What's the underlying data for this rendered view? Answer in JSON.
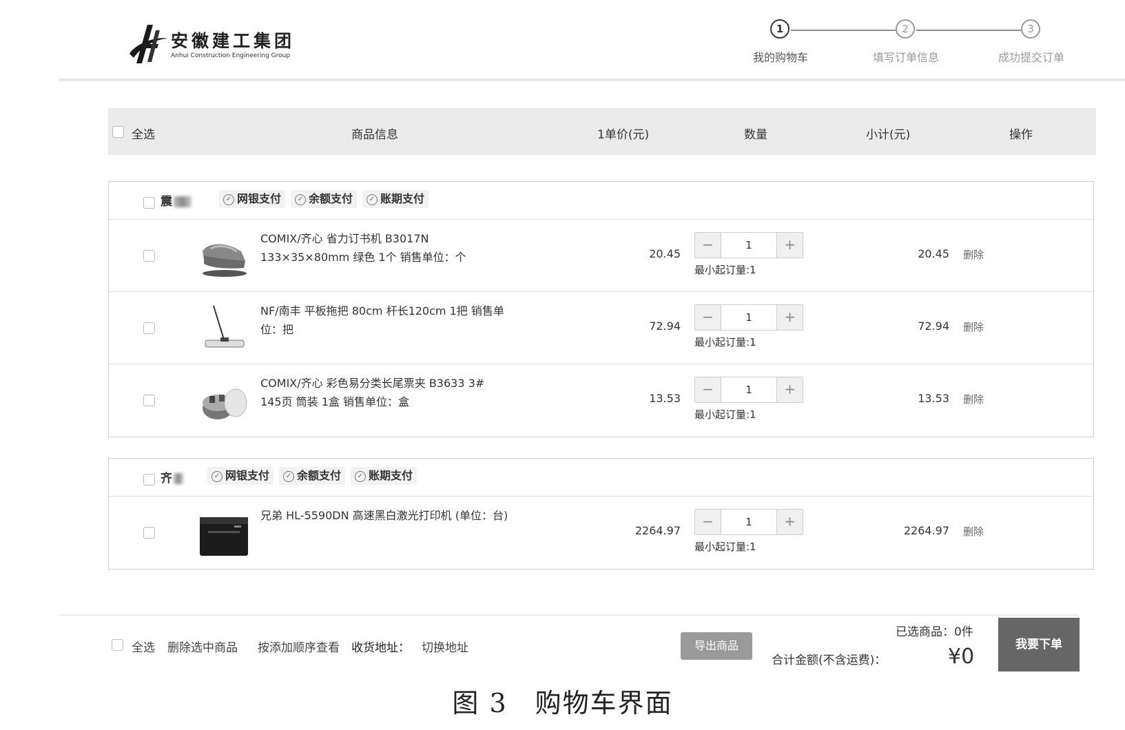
{
  "brand": {
    "name_cn": "安徽建工集团",
    "name_en": "Anhui Construction Engineering Group"
  },
  "steps": [
    {
      "number": "1",
      "label": "我的购物车"
    },
    {
      "number": "2",
      "label": "填写订单信息"
    },
    {
      "number": "3",
      "label": "成功提交订单"
    }
  ],
  "table_header": {
    "select_all": "全选",
    "product_info": "商品信息",
    "unit_price": "1单价(元)",
    "quantity": "数量",
    "subtotal": "小计(元)",
    "action": "操作"
  },
  "shops": [
    {
      "name": "震",
      "payments": [
        "网银支付",
        "余额支付",
        "账期支付"
      ],
      "items": [
        {
          "name": "COMIX/齐心 省力订书机 B3017N 133×35×80mm 绿色 1个 销售单位：个",
          "price": "20.45",
          "qty": "1",
          "min_order": "最小起订量:1",
          "subtotal": "20.45",
          "delete": "删除"
        },
        {
          "name": "NF/南丰 平板拖把 80cm 杆长120cm 1把 销售单位：把",
          "price": "72.94",
          "qty": "1",
          "min_order": "最小起订量:1",
          "subtotal": "72.94",
          "delete": "删除"
        },
        {
          "name": "COMIX/齐心 彩色易分类长尾票夹 B3633 3# 145页 筒装 1盒 销售单位：盒",
          "price": "13.53",
          "qty": "1",
          "min_order": "最小起订量:1",
          "subtotal": "13.53",
          "delete": "删除"
        }
      ]
    },
    {
      "name": "齐",
      "payments": [
        "网银支付",
        "余额支付",
        "账期支付"
      ],
      "items": [
        {
          "name": "兄弟 HL-5590DN 高速黑白激光打印机 (单位：台)",
          "price": "2264.97",
          "qty": "1",
          "min_order": "最小起订量:1",
          "subtotal": "2264.97",
          "delete": "删除"
        }
      ]
    }
  ],
  "qty_controls": {
    "minus": "−",
    "plus": "+"
  },
  "footer": {
    "select_all": "全选",
    "delete_selected": "删除选中商品",
    "sort_by_added": "按添加顺序查看",
    "address_label": "收货地址：",
    "switch_address": "切换地址",
    "export": "导出商品",
    "selected_count": "已选商品：0件",
    "total_label": "合计金额(不含运费)：",
    "total_value": "¥0",
    "order_button": "我要下单"
  },
  "caption": "图 3　购物车界面"
}
